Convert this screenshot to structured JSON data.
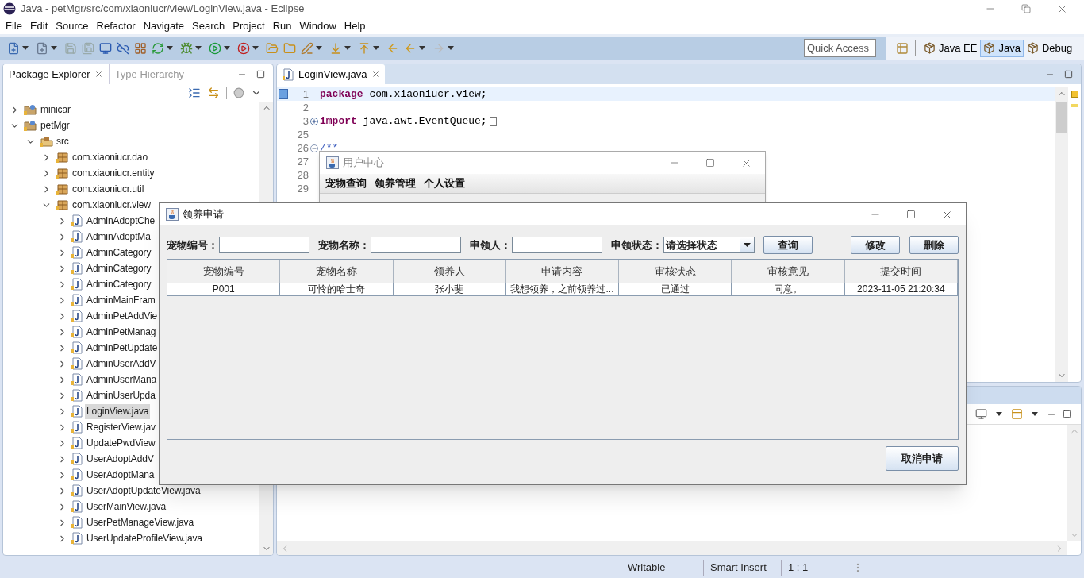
{
  "window": {
    "title": "Java - petMgr/src/com/xiaoniucr/view/LoginView.java - Eclipse"
  },
  "menu": [
    "File",
    "Edit",
    "Source",
    "Refactor",
    "Navigate",
    "Search",
    "Project",
    "Run",
    "Window",
    "Help"
  ],
  "quick_access": {
    "placeholder": "Quick Access"
  },
  "perspectives": [
    {
      "label": "Java EE",
      "selected": false
    },
    {
      "label": "Java",
      "selected": true
    },
    {
      "label": "Debug",
      "selected": false
    }
  ],
  "package_explorer": {
    "tabs": [
      {
        "label": "Package Explorer",
        "selected": true
      },
      {
        "label": "Type Hierarchy",
        "selected": false
      }
    ],
    "tree": [
      {
        "label": "minicar",
        "kind": "project",
        "expanded": false,
        "selected": false
      },
      {
        "label": "petMgr",
        "kind": "project",
        "expanded": true,
        "selected": false,
        "children": [
          {
            "label": "src",
            "kind": "folder",
            "expanded": true,
            "selected": false,
            "children": [
              {
                "label": "com.xiaoniucr.dao",
                "kind": "package",
                "expanded": false,
                "selected": false
              },
              {
                "label": "com.xiaoniucr.entity",
                "kind": "package",
                "expanded": false,
                "selected": false
              },
              {
                "label": "com.xiaoniucr.util",
                "kind": "package",
                "expanded": false,
                "selected": false
              },
              {
                "label": "com.xiaoniucr.view",
                "kind": "package",
                "expanded": true,
                "selected": false,
                "children": [
                  {
                    "label": "AdminAdoptChe",
                    "kind": "file",
                    "expanded": false,
                    "selected": false
                  },
                  {
                    "label": "AdminAdoptMa",
                    "kind": "file",
                    "expanded": false,
                    "selected": false
                  },
                  {
                    "label": "AdminCategory",
                    "kind": "file",
                    "expanded": false,
                    "selected": false
                  },
                  {
                    "label": "AdminCategory",
                    "kind": "file",
                    "expanded": false,
                    "selected": false
                  },
                  {
                    "label": "AdminCategory",
                    "kind": "file",
                    "expanded": false,
                    "selected": false
                  },
                  {
                    "label": "AdminMainFram",
                    "kind": "file",
                    "expanded": false,
                    "selected": false
                  },
                  {
                    "label": "AdminPetAddVie",
                    "kind": "file",
                    "expanded": false,
                    "selected": false
                  },
                  {
                    "label": "AdminPetManag",
                    "kind": "file",
                    "expanded": false,
                    "selected": false
                  },
                  {
                    "label": "AdminPetUpdate",
                    "kind": "file",
                    "expanded": false,
                    "selected": false
                  },
                  {
                    "label": "AdminUserAddV",
                    "kind": "file",
                    "expanded": false,
                    "selected": false
                  },
                  {
                    "label": "AdminUserMana",
                    "kind": "file",
                    "expanded": false,
                    "selected": false
                  },
                  {
                    "label": "AdminUserUpda",
                    "kind": "file",
                    "expanded": false,
                    "selected": false
                  },
                  {
                    "label": "LoginView.java",
                    "kind": "file",
                    "expanded": false,
                    "selected": true
                  },
                  {
                    "label": "RegisterView.jav",
                    "kind": "file",
                    "expanded": false,
                    "selected": false
                  },
                  {
                    "label": "UpdatePwdView",
                    "kind": "file",
                    "expanded": false,
                    "selected": false
                  },
                  {
                    "label": "UserAdoptAddV",
                    "kind": "file",
                    "expanded": false,
                    "selected": false
                  },
                  {
                    "label": "UserAdoptMana",
                    "kind": "file",
                    "expanded": false,
                    "selected": false
                  },
                  {
                    "label": "UserAdoptUpdateView.java",
                    "kind": "file",
                    "expanded": false,
                    "selected": false
                  },
                  {
                    "label": "UserMainView.java",
                    "kind": "file",
                    "expanded": false,
                    "selected": false
                  },
                  {
                    "label": "UserPetManageView.java",
                    "kind": "file",
                    "expanded": false,
                    "selected": false
                  },
                  {
                    "label": "UserUpdateProfileView.java",
                    "kind": "file",
                    "expanded": false,
                    "selected": false
                  }
                ]
              }
            ]
          }
        ]
      }
    ]
  },
  "editor": {
    "tabs": [
      {
        "label": "LoginView.java",
        "selected": true
      }
    ],
    "lines": [
      {
        "number": "1",
        "current": true,
        "tokens": [
          {
            "text": "package",
            "kind": "keyword"
          },
          {
            "text": " com.xiaoniucr.view;",
            "kind": "plain"
          }
        ]
      },
      {
        "number": "2",
        "current": false
      },
      {
        "number": "3",
        "current": false,
        "collapsed": true,
        "tokens": [
          {
            "text": "import",
            "kind": "keyword"
          },
          {
            "text": " java.awt.EventQueue;",
            "kind": "plain"
          }
        ]
      },
      {
        "number": "25",
        "current": false
      },
      {
        "number": "26",
        "current": false,
        "collapsed": false,
        "tokens": [
          {
            "text": "/**",
            "kind": "comment"
          }
        ]
      },
      {
        "number": "27",
        "current": false
      },
      {
        "number": "28",
        "current": false
      },
      {
        "number": "29",
        "current": false
      }
    ]
  },
  "status_bar": [
    "Writable",
    "Smart Insert",
    "1 : 1"
  ],
  "user_center_window": {
    "title": "用户中心",
    "menu": [
      "宠物查询",
      "领养管理",
      "个人设置"
    ]
  },
  "adopt_dialog": {
    "title": "领养申请",
    "filters": [
      {
        "label": "宠物编号：",
        "kind": "text"
      },
      {
        "label": "宠物名称：",
        "kind": "text"
      },
      {
        "label": "申领人：",
        "kind": "text"
      },
      {
        "label": "申领状态：",
        "kind": "select",
        "value": "请选择状态"
      }
    ],
    "search_button": "查询",
    "actions": [
      "修改",
      "删除"
    ],
    "table": {
      "columns": [
        "宠物编号",
        "宠物名称",
        "领养人",
        "申请内容",
        "审核状态",
        "审核意见",
        "提交时间"
      ],
      "rows": [
        {
          "selected": false,
          "cells": [
            "P001",
            "可怜的哈士奇",
            "张小斐",
            "我想领养，之前领养过...",
            "已通过",
            "同意。",
            "2023-11-05 21:20:34"
          ]
        }
      ]
    },
    "cancel_button": "取消申请"
  }
}
